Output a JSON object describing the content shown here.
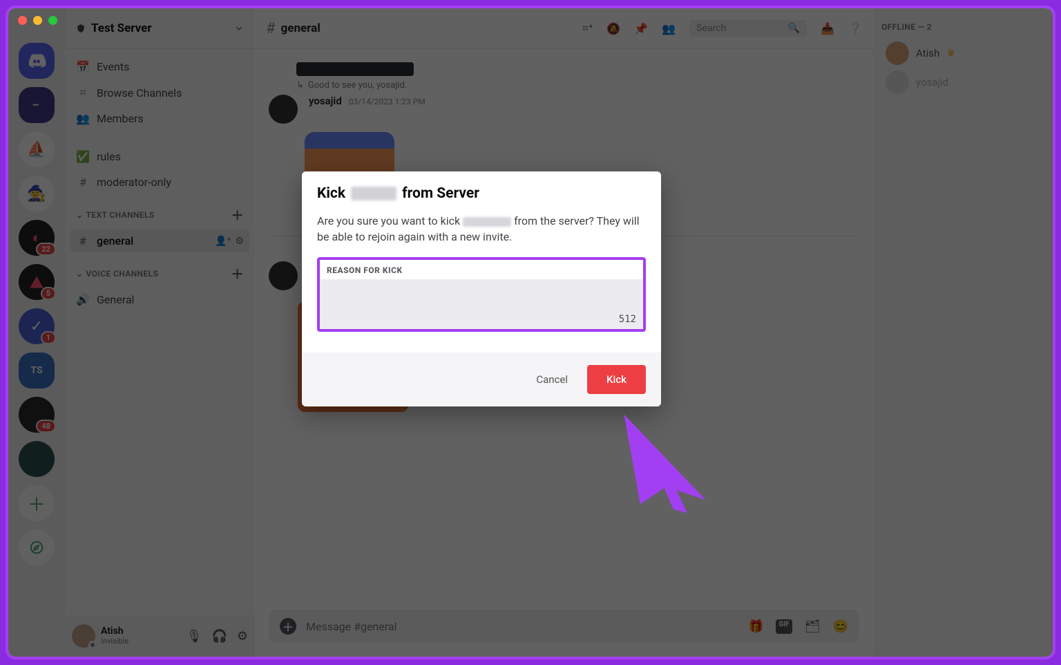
{
  "server": {
    "name": "Test Server"
  },
  "sidebar": {
    "events": "Events",
    "browse": "Browse Channels",
    "members": "Members",
    "rules": "rules",
    "mod_only": "moderator-only",
    "section_text": "TEXT CHANNELS",
    "section_voice": "VOICE CHANNELS",
    "text_general": "general",
    "voice_general": "General"
  },
  "user_panel": {
    "name": "Atish",
    "status": "Invisible"
  },
  "chat": {
    "channel_name": "general",
    "reply_preview": "Good to see you, yosajid.",
    "msg_author": "yosajid",
    "msg_time": "03/14/2023 1:23 PM",
    "compose_placeholder": "Message #general",
    "search_placeholder": "Search"
  },
  "member_list": {
    "offline_header": "OFFLINE — 2",
    "member1": "Atish",
    "member2": "yosajid"
  },
  "modal": {
    "title_prefix": "Kick",
    "title_suffix": "from Server",
    "ask_prefix": "Are you sure you want to kick",
    "ask_suffix": "from the server? They will be able to rejoin again with a new invite.",
    "reason_label": "REASON FOR KICK",
    "char_limit": "512",
    "cancel_label": "Cancel",
    "kick_label": "Kick"
  },
  "server_badges": {
    "b1": "22",
    "b2": "5",
    "b3": "1",
    "b4": "48"
  }
}
